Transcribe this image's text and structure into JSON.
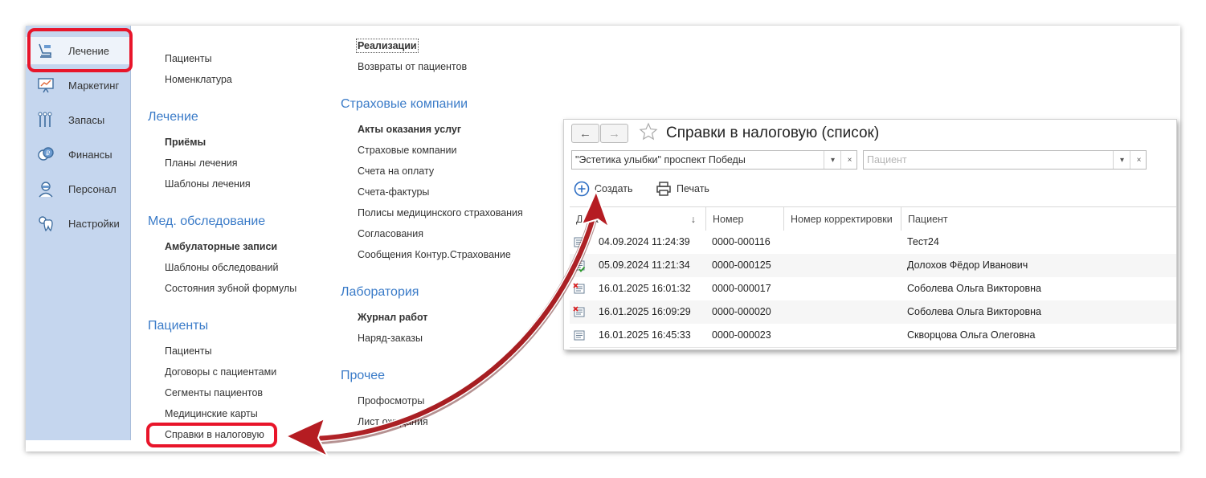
{
  "sidebar": {
    "items": [
      {
        "label": "Лечение",
        "icon": "dental-chair-icon",
        "active": true
      },
      {
        "label": "Маркетинг",
        "icon": "presentation-icon"
      },
      {
        "label": "Запасы",
        "icon": "dental-tools-icon"
      },
      {
        "label": "Финансы",
        "icon": "coins-ruble-icon"
      },
      {
        "label": "Персонал",
        "icon": "doctor-icon"
      },
      {
        "label": "Настройки",
        "icon": "tooth-gear-icon"
      }
    ]
  },
  "menu": {
    "col1": {
      "top_links": [
        "Пациенты",
        "Номенклатура"
      ],
      "sections": [
        {
          "title": "Лечение",
          "links": [
            "Приёмы",
            "Планы лечения",
            "Шаблоны лечения"
          ]
        },
        {
          "title": "Мед. обследование",
          "links": [
            "Амбулаторные записи",
            "Шаблоны обследований",
            "Состояния зубной формулы"
          ]
        },
        {
          "title": "Пациенты",
          "links": [
            "Пациенты",
            "Договоры с пациентами",
            "Сегменты пациентов",
            "Медицинские карты",
            "Справки в налоговую"
          ]
        }
      ]
    },
    "col2": {
      "top_links": [
        "Реализации",
        "Возвраты от пациентов"
      ],
      "sections": [
        {
          "title": "Страховые компании",
          "links": [
            "Акты оказания услуг",
            "Страховые компании",
            "Счета на оплату",
            "Счета-фактуры",
            "Полисы медицинского страхования",
            "Согласования",
            "Сообщения Контур.Страхование"
          ]
        },
        {
          "title": "Лаборатория",
          "links": [
            "Журнал работ",
            "Наряд-заказы"
          ]
        },
        {
          "title": "Прочее",
          "links": [
            "Профосмотры",
            "Лист ожидания"
          ]
        }
      ]
    }
  },
  "window": {
    "title": "Справки в налоговую (список)",
    "filter_clinic": "\"Эстетика улыбки\" проспект Победы",
    "filter_patient_placeholder": "Пациент",
    "create_label": "Создать",
    "print_label": "Печать",
    "columns": [
      "Дата",
      "Номер",
      "Номер корректировки",
      "Пациент"
    ],
    "rows": [
      {
        "date": "04.09.2024 11:24:39",
        "number": "0000-000116",
        "correction": "",
        "patient": "Тест24",
        "status": "posted"
      },
      {
        "date": "05.09.2024 11:21:34",
        "number": "0000-000125",
        "correction": "",
        "patient": "Долохов Фёдор Иванович",
        "status": "posted"
      },
      {
        "date": "16.01.2025 16:01:32",
        "number": "0000-000017",
        "correction": "",
        "patient": "Соболева Ольга Викторовна",
        "status": "deleted"
      },
      {
        "date": "16.01.2025 16:09:29",
        "number": "0000-000020",
        "correction": "",
        "patient": "Соболева Ольга Викторовна",
        "status": "deleted"
      },
      {
        "date": "16.01.2025 16:45:33",
        "number": "0000-000023",
        "correction": "",
        "patient": "Скворцова Ольга Олеговна",
        "status": "draft"
      }
    ]
  },
  "colors": {
    "accent": "#3a7bc8",
    "highlight": "#e8152a",
    "arrow": "#b51c22"
  }
}
